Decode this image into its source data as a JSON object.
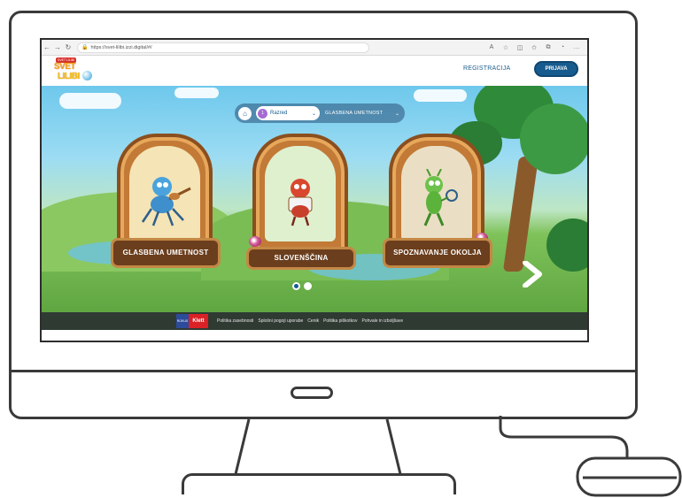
{
  "browser": {
    "url": "https://svet-lilibi.izzi.digital/#/",
    "back_icon": "arrow-left-icon",
    "forward_icon": "arrow-right-icon",
    "refresh_icon": "refresh-icon"
  },
  "header": {
    "logo_tag": "SVET LILIBI",
    "logo_word1": "SVET",
    "logo_word2": "LILIBI",
    "register_label": "REGISTRACIJA",
    "login_label": "PRIJAVA"
  },
  "breadcrumb": {
    "grade_badge": "1",
    "grade_label": "Razred",
    "subject_label": "GLASBENA UMETNOST"
  },
  "cards": [
    {
      "label": "GLASBENA UMETNOST",
      "bg": "#f4e4b6"
    },
    {
      "label": "SLOVENŠČINA",
      "bg": "#dff0cf"
    },
    {
      "label": "SPOZNAVANJE OKOLJA",
      "bg": "#eadfc4"
    }
  ],
  "pager": {
    "active_index": 0,
    "total": 2
  },
  "footer": {
    "rokus": "ROKUS",
    "klett": "Klett",
    "links": [
      "Politika zasebnosti",
      "Splošni pogoji uporabe",
      "Cenik",
      "Politika piškotkov",
      "Pohvale in izboljšave"
    ]
  },
  "colors": {
    "brand_blue": "#175b8e",
    "card_brown": "#6b3e1d",
    "klett_red": "#d92126"
  }
}
